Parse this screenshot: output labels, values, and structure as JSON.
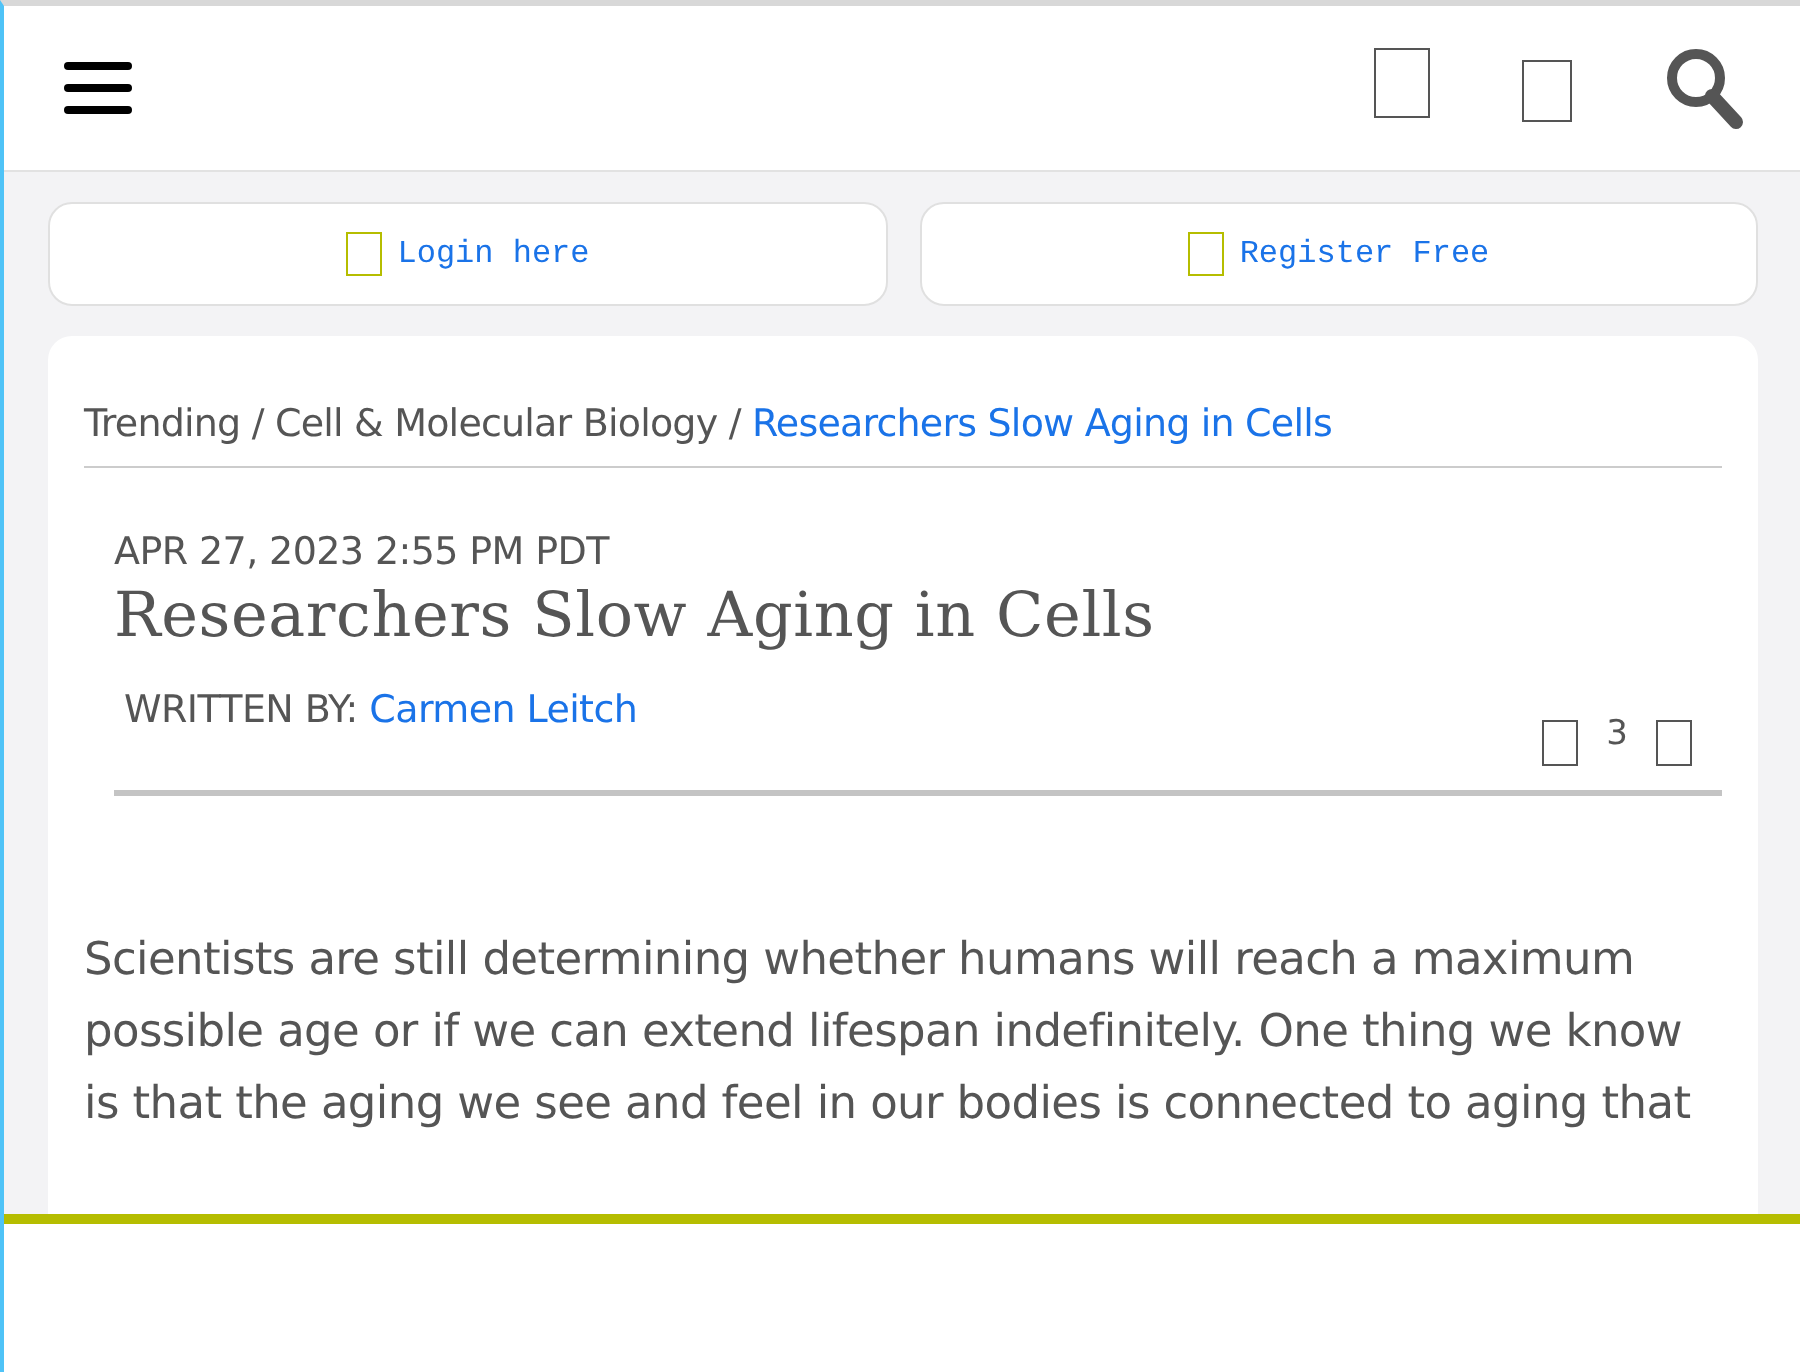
{
  "breadcrumb_separator": "/",
  "account_buttons": [
    {
      "label": "Login here"
    },
    {
      "label": "Register Free"
    }
  ],
  "breadcrumb": [
    {
      "label": "Trending",
      "current": false
    },
    {
      "label": "Cell & Molecular Biology",
      "current": false
    },
    {
      "label": "Researchers Slow Aging in Cells",
      "current": true
    }
  ],
  "article": {
    "date": "APR 27, 2023 2:55 PM PDT",
    "title": "Researchers Slow Aging in Cells",
    "byline_label": "WRITTEN BY:",
    "author": "Carmen Leitch",
    "comment_count": "3",
    "body": "Scientists are still determining whether humans will reach a maximum possible age or if we can extend lifespan indefinitely. One thing we know is that the aging we see and feel in our bodies is connected to aging that"
  }
}
